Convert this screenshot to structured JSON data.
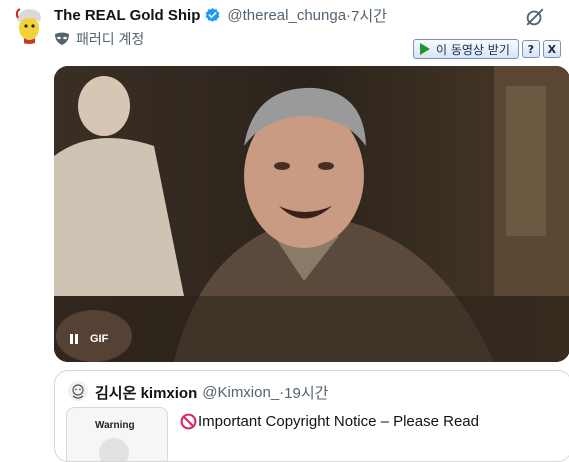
{
  "post": {
    "display_name": "The REAL Gold Ship",
    "handle": "@thereal_chunga",
    "separator": " · ",
    "time": "7시간",
    "parody_label": "패러디 계정",
    "icons": {
      "verified": "verified-badge-icon",
      "grok": "grok-icon",
      "parody": "mask-icon"
    }
  },
  "video_toolbar": {
    "download_label": "이 동영상 받기",
    "help_label": "?",
    "close_label": "X"
  },
  "media": {
    "type": "gif",
    "badge": "GIF",
    "pause_icon": "pause-icon"
  },
  "quote": {
    "display_name": "김시온 kimxion",
    "handle": "@Kimxion_",
    "separator": " · ",
    "time": "19시간",
    "thumb_label": "Warning",
    "text": "Important Copyright Notice – Please Read",
    "text_icon": "prohibited-icon"
  },
  "colors": {
    "text": "#0f1419",
    "secondary": "#536471",
    "verified": "#1d9bf0",
    "border": "#cfd9de",
    "prohibited": "#e0245e"
  }
}
